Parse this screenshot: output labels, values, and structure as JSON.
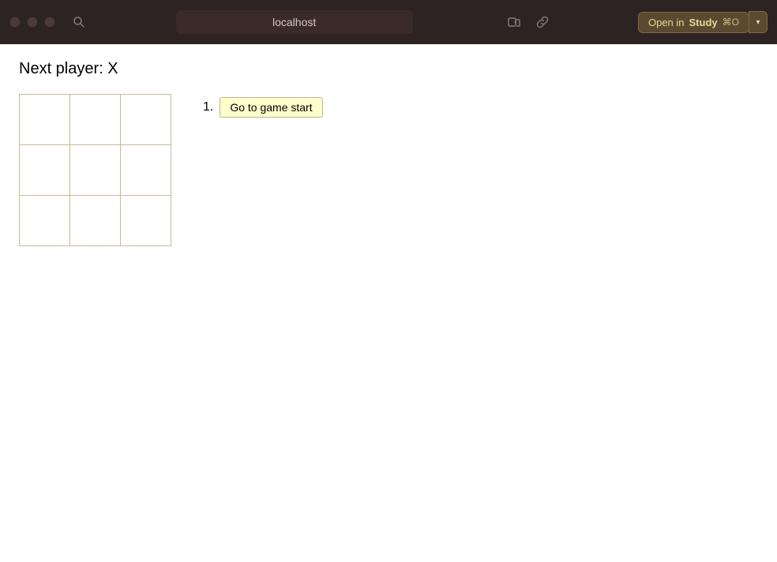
{
  "titlebar": {
    "address": "localhost",
    "open_study_label_prefix": "Open in ",
    "open_study_label_bold": "Study",
    "open_study_shortcut": "⌘O",
    "dropdown_arrow": "▾"
  },
  "game": {
    "next_player_label": "Next player: X",
    "board": {
      "cells": [
        "",
        "",
        "",
        "",
        "",
        "",
        "",
        "",
        ""
      ]
    },
    "history": [
      {
        "number": "1.",
        "label": "Go to game start"
      }
    ]
  },
  "icons": {
    "search": "🔍",
    "tab_icon": "⎋",
    "link_icon": "🔗"
  }
}
